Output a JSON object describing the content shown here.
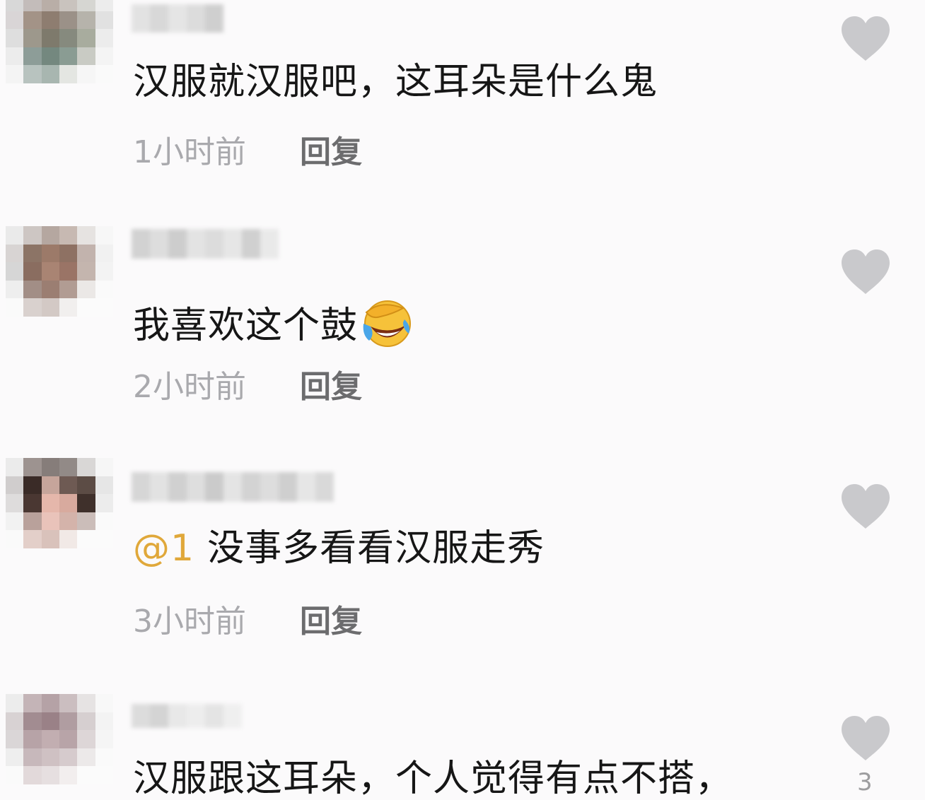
{
  "comments": [
    {
      "text": "汉服就汉服吧，这耳朵是什么鬼",
      "time": "1小时前",
      "reply": "回复",
      "like_icon": "heart-icon"
    },
    {
      "text": "我喜欢这个鼓",
      "emoji": "laughing-crying-emoji",
      "time": "2小时前",
      "reply": "回复",
      "like_icon": "heart-icon"
    },
    {
      "mention": "@1",
      "text": "没事多看看汉服走秀",
      "time": "3小时前",
      "reply": "回复",
      "like_icon": "heart-icon"
    },
    {
      "text": "汉服跟这耳朵，个人觉得有点不搭，",
      "like_icon": "heart-icon",
      "like_count": "3"
    }
  ],
  "colors": {
    "background": "#fbfafb",
    "text": "#161616",
    "timestamp": "#a9a9ad",
    "reply": "#6c6c6e",
    "mention": "#e0a83a",
    "heart": "#c9c9cc"
  }
}
